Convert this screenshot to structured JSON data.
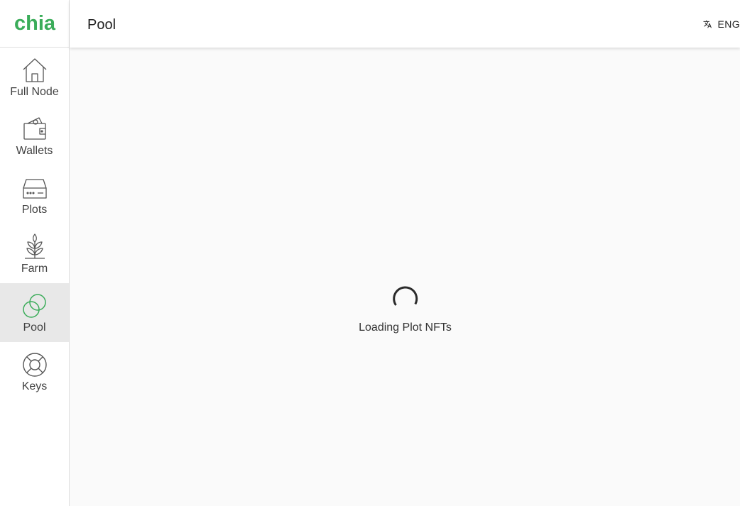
{
  "app": {
    "name": "chia",
    "brand_color": "#3aac59"
  },
  "sidebar": {
    "items": [
      {
        "label": "Full Node",
        "icon": "home-icon"
      },
      {
        "label": "Wallets",
        "icon": "wallet-icon"
      },
      {
        "label": "Plots",
        "icon": "hard-drive-icon"
      },
      {
        "label": "Farm",
        "icon": "plant-icon"
      },
      {
        "label": "Pool",
        "icon": "pool-rings-icon",
        "active": true
      },
      {
        "label": "Keys",
        "icon": "lifebuoy-icon"
      }
    ]
  },
  "header": {
    "title": "Pool",
    "language": {
      "icon": "translate-icon",
      "label": "ENG"
    }
  },
  "main": {
    "loading_text": "Loading Plot NFTs"
  }
}
